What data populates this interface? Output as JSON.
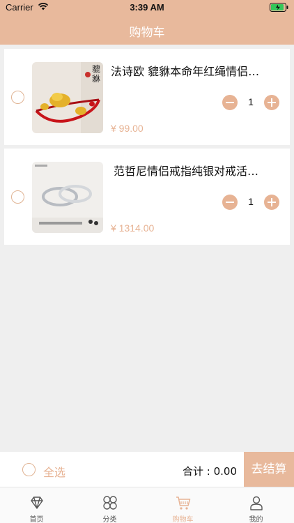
{
  "status_bar": {
    "carrier": "Carrier",
    "time": "3:39 AM"
  },
  "nav": {
    "title": "购物车"
  },
  "cart": {
    "items": [
      {
        "title": "法诗欧 貔貅本命年红绳情侣…",
        "quantity": "1",
        "price": "¥ 99.00",
        "checked": false
      },
      {
        "title": "范哲尼情侣戒指纯银对戒活…",
        "quantity": "1",
        "price": "¥ 1314.00",
        "checked": false
      }
    ]
  },
  "checkout": {
    "select_all": "全选",
    "total": "合计 : 0.00",
    "button": "去结算"
  },
  "tabbar": {
    "tabs": [
      {
        "label": "首页",
        "icon": "diamond-icon",
        "active": false
      },
      {
        "label": "分类",
        "icon": "grid-icon",
        "active": false
      },
      {
        "label": "购物车",
        "icon": "cart-icon",
        "active": true
      },
      {
        "label": "我的",
        "icon": "person-icon",
        "active": false
      }
    ]
  },
  "colors": {
    "accent": "#e8b99c",
    "price": "#e7b394",
    "background": "#efefef"
  }
}
